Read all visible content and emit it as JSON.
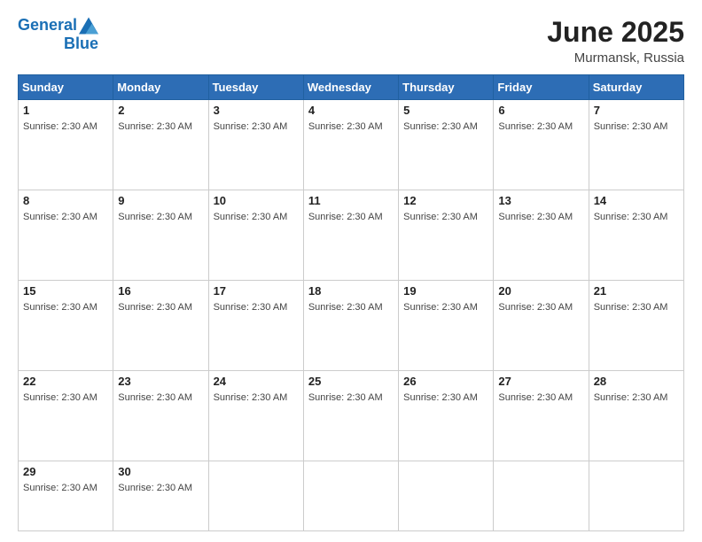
{
  "header": {
    "logo_line1": "General",
    "logo_line2": "Blue",
    "month_title": "June 2025",
    "location": "Murmansk, Russia"
  },
  "days_of_week": [
    "Sunday",
    "Monday",
    "Tuesday",
    "Wednesday",
    "Thursday",
    "Friday",
    "Saturday"
  ],
  "sunrise_text": "Sunrise: 2:30 AM",
  "weeks": [
    [
      {
        "day": "1",
        "sunrise": "Sunrise: 2:30 AM"
      },
      {
        "day": "2",
        "sunrise": "Sunrise: 2:30 AM"
      },
      {
        "day": "3",
        "sunrise": "Sunrise: 2:30 AM"
      },
      {
        "day": "4",
        "sunrise": "Sunrise: 2:30 AM"
      },
      {
        "day": "5",
        "sunrise": "Sunrise: 2:30 AM"
      },
      {
        "day": "6",
        "sunrise": "Sunrise: 2:30 AM"
      },
      {
        "day": "7",
        "sunrise": "Sunrise: 2:30 AM"
      }
    ],
    [
      {
        "day": "8",
        "sunrise": "Sunrise: 2:30 AM"
      },
      {
        "day": "9",
        "sunrise": "Sunrise: 2:30 AM"
      },
      {
        "day": "10",
        "sunrise": "Sunrise: 2:30 AM"
      },
      {
        "day": "11",
        "sunrise": "Sunrise: 2:30 AM"
      },
      {
        "day": "12",
        "sunrise": "Sunrise: 2:30 AM"
      },
      {
        "day": "13",
        "sunrise": "Sunrise: 2:30 AM"
      },
      {
        "day": "14",
        "sunrise": "Sunrise: 2:30 AM"
      }
    ],
    [
      {
        "day": "15",
        "sunrise": "Sunrise: 2:30 AM"
      },
      {
        "day": "16",
        "sunrise": "Sunrise: 2:30 AM"
      },
      {
        "day": "17",
        "sunrise": "Sunrise: 2:30 AM"
      },
      {
        "day": "18",
        "sunrise": "Sunrise: 2:30 AM"
      },
      {
        "day": "19",
        "sunrise": "Sunrise: 2:30 AM"
      },
      {
        "day": "20",
        "sunrise": "Sunrise: 2:30 AM"
      },
      {
        "day": "21",
        "sunrise": "Sunrise: 2:30 AM"
      }
    ],
    [
      {
        "day": "22",
        "sunrise": "Sunrise: 2:30 AM"
      },
      {
        "day": "23",
        "sunrise": "Sunrise: 2:30 AM"
      },
      {
        "day": "24",
        "sunrise": "Sunrise: 2:30 AM"
      },
      {
        "day": "25",
        "sunrise": "Sunrise: 2:30 AM"
      },
      {
        "day": "26",
        "sunrise": "Sunrise: 2:30 AM"
      },
      {
        "day": "27",
        "sunrise": "Sunrise: 2:30 AM"
      },
      {
        "day": "28",
        "sunrise": "Sunrise: 2:30 AM"
      }
    ],
    [
      {
        "day": "29",
        "sunrise": "Sunrise: 2:30 AM"
      },
      {
        "day": "30",
        "sunrise": "Sunrise: 2:30 AM"
      },
      {
        "day": "",
        "sunrise": ""
      },
      {
        "day": "",
        "sunrise": ""
      },
      {
        "day": "",
        "sunrise": ""
      },
      {
        "day": "",
        "sunrise": ""
      },
      {
        "day": "",
        "sunrise": ""
      }
    ]
  ]
}
